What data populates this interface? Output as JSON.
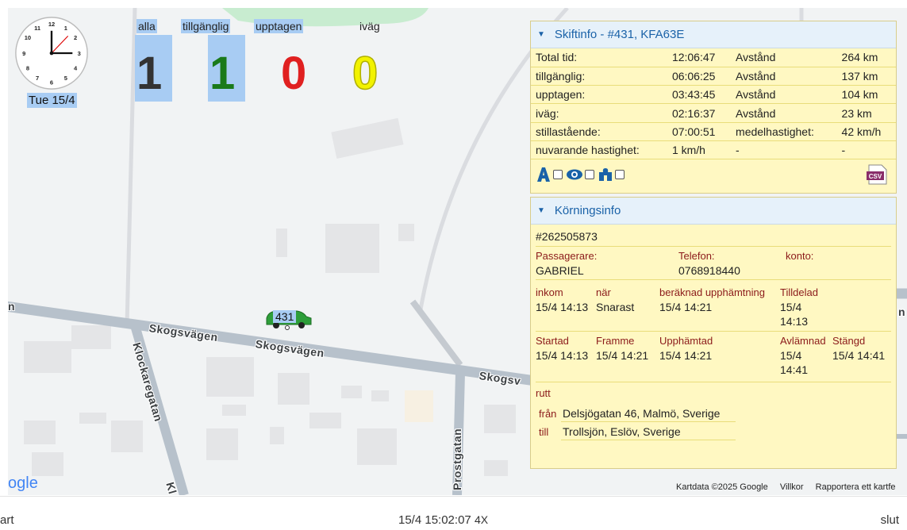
{
  "map": {
    "streets": [
      "Skogsvägen",
      "Skogsvägen",
      "Skogsv",
      "Klockaregatan",
      "Prostgatan",
      "Kl"
    ],
    "google_logo": "ogle",
    "attribution": [
      "Kartdata ©2025 Google",
      "Villkor",
      "Rapportera ett kartfe"
    ],
    "edge_labels": [
      "n",
      "n"
    ]
  },
  "clock": {
    "date": "Tue 15/4"
  },
  "counters": [
    {
      "label": "alla",
      "value": "1",
      "color": "#333333"
    },
    {
      "label": "tillgänglig",
      "value": "1",
      "color": "#1a7a1a"
    },
    {
      "label": "upptagen",
      "value": "0",
      "color": "#e02020"
    },
    {
      "label": "iväg",
      "value": "0",
      "color": "#f2f200"
    }
  ],
  "car": {
    "label": "431",
    "color": "#2e9e3a"
  },
  "shift_panel": {
    "title": "Skiftinfo - #431, KFA63E",
    "rows": [
      [
        "Total tid:",
        "12:06:47",
        "Avstånd",
        "264 km"
      ],
      [
        "tillgänglig:",
        "06:06:25",
        "Avstånd",
        "137 km"
      ],
      [
        "upptagen:",
        "03:43:45",
        "Avstånd",
        "104 km"
      ],
      [
        "iväg:",
        "02:16:37",
        "Avstånd",
        "23 km"
      ],
      [
        "stillastående:",
        "07:00:51",
        "medelhastighet:",
        "42 km/h"
      ],
      [
        "nuvarande hastighet:",
        "1 km/h",
        "-",
        "-"
      ]
    ],
    "icons": [
      "road-icon",
      "eye-icon",
      "puzzle-icon"
    ],
    "csv_label": "CSV"
  },
  "run_panel": {
    "title": "Körningsinfo",
    "id": "#262505873",
    "passenger_label": "Passagerare:",
    "phone_label": "Telefon:",
    "account_label": "konto:",
    "passenger": "GABRIEL",
    "phone": "0768918440",
    "row1_labels": [
      "inkom",
      "när",
      "beräknad upphämtning",
      "Tilldelad"
    ],
    "row1_values": [
      "15/4 14:13",
      "Snarast",
      "15/4 14:21",
      "15/4",
      "14:13"
    ],
    "row2_labels": [
      "Startad",
      "Framme",
      "Upphämtad",
      "Avlämnad",
      "Stängd"
    ],
    "row2_values": [
      "15/4 14:13",
      "15/4 14:21",
      "15/4 14:21",
      "15/4",
      "14:41",
      "15/4 14:41"
    ],
    "route_label": "rutt",
    "from_label": "från",
    "from": "Delsjögatan 46, Malmö, Sverige",
    "to_label": "till",
    "to": "Trollsjön, Eslöv, Sverige"
  },
  "bottom": {
    "start": "art",
    "timestamp": "15/4 15:02:07",
    "speed": "4X",
    "end": "slut"
  }
}
